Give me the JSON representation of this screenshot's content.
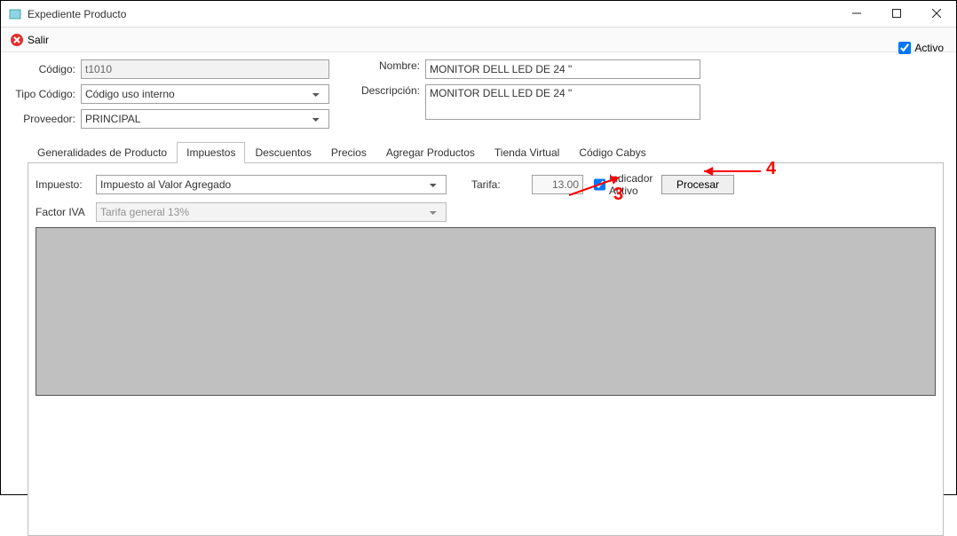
{
  "window": {
    "title": "Expediente Producto"
  },
  "toolbar": {
    "salir": "Salir"
  },
  "activo": {
    "label": "Activo",
    "checked": true
  },
  "form": {
    "codigo_label": "Código:",
    "codigo_value": "t1010",
    "tipo_codigo_label": "Tipo Código:",
    "tipo_codigo_value": "Código uso interno",
    "proveedor_label": "Proveedor:",
    "proveedor_value": "PRINCIPAL",
    "nombre_label": "Nombre:",
    "nombre_value": "MONITOR DELL LED DE 24 \"",
    "descripcion_label": "Descripción:",
    "descripcion_value": "MONITOR DELL LED DE 24 \""
  },
  "tabs": {
    "generalidades": "Generalidades de Producto",
    "impuestos": "Impuestos",
    "descuentos": "Descuentos",
    "precios": "Precios",
    "agregar": "Agregar Productos",
    "tienda": "Tienda Virtual",
    "cabys": "Código Cabys"
  },
  "impuestos": {
    "impuesto_label": "Impuesto:",
    "impuesto_value": "Impuesto al Valor Agregado",
    "factor_label": "Factor IVA",
    "factor_value": "Tarifa general 13%",
    "tarifa_label": "Tarifa:",
    "tarifa_value": "13.00",
    "indicador_label": "Indicador Activo",
    "indicador_checked": true,
    "procesar_label": "Procesar"
  },
  "annotations": {
    "three": "3",
    "four": "4"
  }
}
